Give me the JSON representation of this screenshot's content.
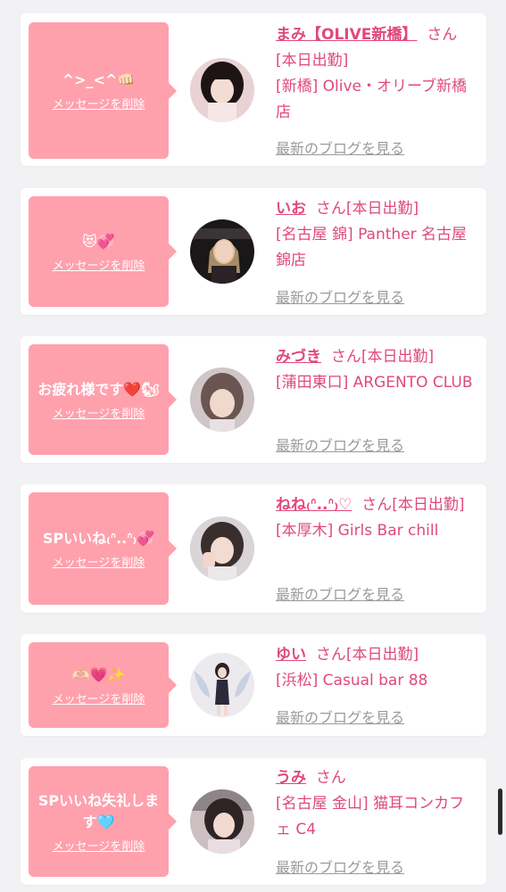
{
  "delete_label": "メッセージを削除",
  "blog_label": "最新のブログを見る",
  "san": "さん",
  "cards": [
    {
      "message": "^>_<^👊🏻",
      "name": "まみ【OLIVE新橋】",
      "status": "[本日出勤]",
      "shop": "[新橋] Olive・オリーブ新橋店"
    },
    {
      "message": "😻💞",
      "name": "いお",
      "status": "[本日出勤]",
      "shop": "[名古屋 錦] Panther 名古屋錦店"
    },
    {
      "message": "お疲れ様です❤️🐿",
      "name": "みづき",
      "status": "[本日出勤]",
      "shop": "[蒲田東口] ARGENTO CLUB"
    },
    {
      "message": "SPいいね₍ᐢ..ᐢ₎💞",
      "name": "ねね₍ᐢ..ᐢ₎♡",
      "status": "[本日出勤]",
      "shop": "[本厚木] Girls Bar chill"
    },
    {
      "message": "🫶🏻💗✨",
      "name": "ゆい",
      "status": "[本日出勤]",
      "shop": "[浜松] Casual bar 88"
    },
    {
      "message": "SPいいね失礼します🩵",
      "name": "うみ",
      "status": "",
      "shop": "[名古屋 金山] 猫耳コンカフェ C4"
    }
  ],
  "colors": {
    "accent": "#e0497a",
    "bubble": "#ffa0ad",
    "link_gray": "#9a9a9a",
    "background": "#f2f2f4"
  }
}
